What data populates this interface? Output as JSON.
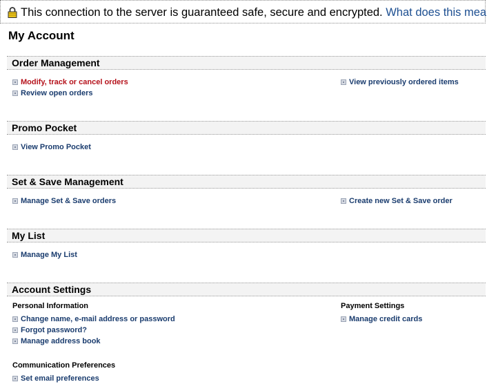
{
  "secure_bar": {
    "message": "This connection to the server is guaranteed safe, secure and encrypted.",
    "link": "What does this mean?"
  },
  "page_title": "My Account",
  "sections": {
    "order_management": {
      "title": "Order Management",
      "links": [
        "Modify, track or cancel orders",
        "Review open orders",
        "View previously ordered items"
      ]
    },
    "promo_pocket": {
      "title": "Promo Pocket",
      "links": [
        "View Promo Pocket"
      ]
    },
    "set_save": {
      "title": "Set & Save Management",
      "links": [
        "Manage Set & Save orders",
        "Create new Set & Save order"
      ]
    },
    "my_list": {
      "title": "My List",
      "links": [
        "Manage My List"
      ]
    },
    "account_settings": {
      "title": "Account Settings",
      "personal": {
        "heading": "Personal Information",
        "links": [
          "Change name, e-mail address or password",
          "Forgot password?",
          "Manage address book"
        ]
      },
      "payment": {
        "heading": "Payment Settings",
        "links": [
          "Manage credit cards"
        ]
      },
      "communication": {
        "heading": "Communication Preferences",
        "links": [
          "Set email preferences"
        ]
      }
    }
  },
  "colors": {
    "link": "#1a3c6e",
    "active_link": "#b5121b",
    "secure_link": "#1d4f91",
    "lock_icon": "#e8c21b"
  }
}
